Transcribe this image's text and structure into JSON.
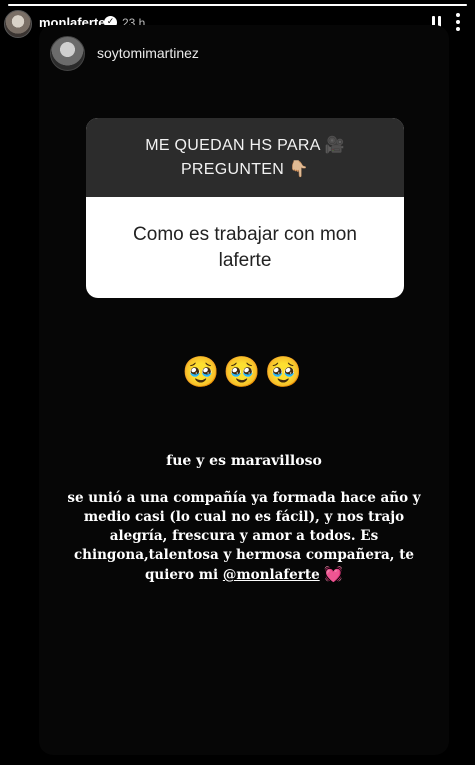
{
  "story": {
    "username": "monlaferte",
    "timestamp": "23 h",
    "progress_percent": 100
  },
  "shared_story": {
    "username": "soytomimartinez",
    "question": {
      "prompt": "ME QUEDAN HS PARA 🎥 PREGUNTEN 👇🏼",
      "answer": "Como es trabajar con mon laferte"
    },
    "emojis": "🥹🥹🥹",
    "line_one": "fue y es maravilloso",
    "message_text": "se unió a una compañía ya formada hace año y medio casi (lo cual no es fácil), y nos trajo alegría, frescura y amor a todos. Es chingona,talentosa y hermosa compañera, te quiero mi ",
    "mention": "@monlaferte",
    "heart": "💓"
  },
  "icons": {
    "verified": "verified-badge",
    "pause": "pause",
    "more": "more-vertical"
  }
}
